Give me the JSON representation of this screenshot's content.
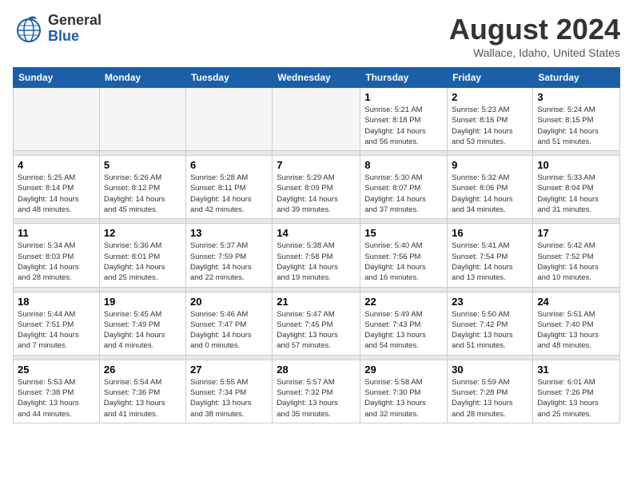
{
  "header": {
    "logo_general": "General",
    "logo_blue": "Blue",
    "title": "August 2024",
    "location": "Wallace, Idaho, United States"
  },
  "days_of_week": [
    "Sunday",
    "Monday",
    "Tuesday",
    "Wednesday",
    "Thursday",
    "Friday",
    "Saturday"
  ],
  "weeks": [
    {
      "cells": [
        {
          "day": "",
          "info": ""
        },
        {
          "day": "",
          "info": ""
        },
        {
          "day": "",
          "info": ""
        },
        {
          "day": "",
          "info": ""
        },
        {
          "day": "1",
          "info": "Sunrise: 5:21 AM\nSunset: 8:18 PM\nDaylight: 14 hours\nand 56 minutes."
        },
        {
          "day": "2",
          "info": "Sunrise: 5:23 AM\nSunset: 8:16 PM\nDaylight: 14 hours\nand 53 minutes."
        },
        {
          "day": "3",
          "info": "Sunrise: 5:24 AM\nSunset: 8:15 PM\nDaylight: 14 hours\nand 51 minutes."
        }
      ]
    },
    {
      "cells": [
        {
          "day": "4",
          "info": "Sunrise: 5:25 AM\nSunset: 8:14 PM\nDaylight: 14 hours\nand 48 minutes."
        },
        {
          "day": "5",
          "info": "Sunrise: 5:26 AM\nSunset: 8:12 PM\nDaylight: 14 hours\nand 45 minutes."
        },
        {
          "day": "6",
          "info": "Sunrise: 5:28 AM\nSunset: 8:11 PM\nDaylight: 14 hours\nand 42 minutes."
        },
        {
          "day": "7",
          "info": "Sunrise: 5:29 AM\nSunset: 8:09 PM\nDaylight: 14 hours\nand 39 minutes."
        },
        {
          "day": "8",
          "info": "Sunrise: 5:30 AM\nSunset: 8:07 PM\nDaylight: 14 hours\nand 37 minutes."
        },
        {
          "day": "9",
          "info": "Sunrise: 5:32 AM\nSunset: 8:06 PM\nDaylight: 14 hours\nand 34 minutes."
        },
        {
          "day": "10",
          "info": "Sunrise: 5:33 AM\nSunset: 8:04 PM\nDaylight: 14 hours\nand 31 minutes."
        }
      ]
    },
    {
      "cells": [
        {
          "day": "11",
          "info": "Sunrise: 5:34 AM\nSunset: 8:03 PM\nDaylight: 14 hours\nand 28 minutes."
        },
        {
          "day": "12",
          "info": "Sunrise: 5:36 AM\nSunset: 8:01 PM\nDaylight: 14 hours\nand 25 minutes."
        },
        {
          "day": "13",
          "info": "Sunrise: 5:37 AM\nSunset: 7:59 PM\nDaylight: 14 hours\nand 22 minutes."
        },
        {
          "day": "14",
          "info": "Sunrise: 5:38 AM\nSunset: 7:58 PM\nDaylight: 14 hours\nand 19 minutes."
        },
        {
          "day": "15",
          "info": "Sunrise: 5:40 AM\nSunset: 7:56 PM\nDaylight: 14 hours\nand 16 minutes."
        },
        {
          "day": "16",
          "info": "Sunrise: 5:41 AM\nSunset: 7:54 PM\nDaylight: 14 hours\nand 13 minutes."
        },
        {
          "day": "17",
          "info": "Sunrise: 5:42 AM\nSunset: 7:52 PM\nDaylight: 14 hours\nand 10 minutes."
        }
      ]
    },
    {
      "cells": [
        {
          "day": "18",
          "info": "Sunrise: 5:44 AM\nSunset: 7:51 PM\nDaylight: 14 hours\nand 7 minutes."
        },
        {
          "day": "19",
          "info": "Sunrise: 5:45 AM\nSunset: 7:49 PM\nDaylight: 14 hours\nand 4 minutes."
        },
        {
          "day": "20",
          "info": "Sunrise: 5:46 AM\nSunset: 7:47 PM\nDaylight: 14 hours\nand 0 minutes."
        },
        {
          "day": "21",
          "info": "Sunrise: 5:47 AM\nSunset: 7:45 PM\nDaylight: 13 hours\nand 57 minutes."
        },
        {
          "day": "22",
          "info": "Sunrise: 5:49 AM\nSunset: 7:43 PM\nDaylight: 13 hours\nand 54 minutes."
        },
        {
          "day": "23",
          "info": "Sunrise: 5:50 AM\nSunset: 7:42 PM\nDaylight: 13 hours\nand 51 minutes."
        },
        {
          "day": "24",
          "info": "Sunrise: 5:51 AM\nSunset: 7:40 PM\nDaylight: 13 hours\nand 48 minutes."
        }
      ]
    },
    {
      "cells": [
        {
          "day": "25",
          "info": "Sunrise: 5:53 AM\nSunset: 7:38 PM\nDaylight: 13 hours\nand 44 minutes."
        },
        {
          "day": "26",
          "info": "Sunrise: 5:54 AM\nSunset: 7:36 PM\nDaylight: 13 hours\nand 41 minutes."
        },
        {
          "day": "27",
          "info": "Sunrise: 5:55 AM\nSunset: 7:34 PM\nDaylight: 13 hours\nand 38 minutes."
        },
        {
          "day": "28",
          "info": "Sunrise: 5:57 AM\nSunset: 7:32 PM\nDaylight: 13 hours\nand 35 minutes."
        },
        {
          "day": "29",
          "info": "Sunrise: 5:58 AM\nSunset: 7:30 PM\nDaylight: 13 hours\nand 32 minutes."
        },
        {
          "day": "30",
          "info": "Sunrise: 5:59 AM\nSunset: 7:28 PM\nDaylight: 13 hours\nand 28 minutes."
        },
        {
          "day": "31",
          "info": "Sunrise: 6:01 AM\nSunset: 7:26 PM\nDaylight: 13 hours\nand 25 minutes."
        }
      ]
    }
  ]
}
